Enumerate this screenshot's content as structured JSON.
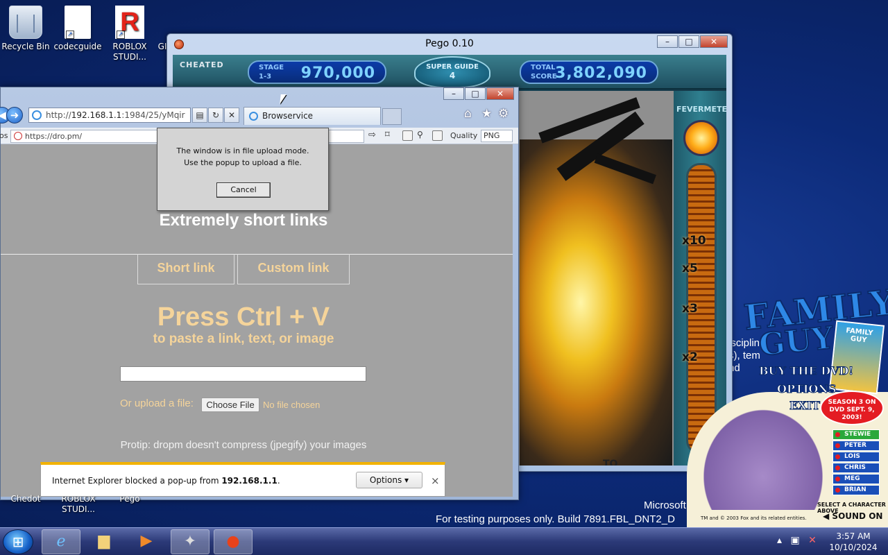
{
  "desktop": {
    "icons": [
      {
        "label": "Recycle Bin",
        "icon": "recycle-bin-icon"
      },
      {
        "label": "codecguide",
        "icon": "document-shortcut-icon"
      },
      {
        "label": "ROBLOX STUDI...",
        "icon": "roblox-icon"
      },
      {
        "label": "GI",
        "icon": "gimp-icon"
      }
    ],
    "bottom_icons": [
      {
        "label": "Chedot"
      },
      {
        "label": "ROBLOX STUDI..."
      },
      {
        "label": "Pego"
      }
    ],
    "watermark_line1": "Microsoft",
    "watermark_line2": "For testing purposes only. Build 7891.FBL_DNT2_D",
    "background_text": [
      "iscipline",
      "s), tem",
      "nd"
    ]
  },
  "pego": {
    "title": "Pego 0.10",
    "cheated_label": "CHEATED",
    "stage_label": "STAGE",
    "stage_value": "1-3",
    "stage_score": "970,000",
    "super_guide_label": "SUPER GUIDE",
    "super_guide_count": "4",
    "total_label": "TOTAL",
    "score_label": "SCORE",
    "total_score": "3,802,090",
    "fevermeter_label": "FEVERMETER",
    "multipliers": [
      "x10",
      "x5",
      "x3",
      "x2"
    ],
    "playfield_label": "TO"
  },
  "browser": {
    "address_prefix": "http://",
    "address_host": "192.168.1.1",
    "address_rest": ":1984/25/yMqir",
    "tab_label": "Browservice",
    "inner_prefix": "os",
    "inner_address": "https://dro.pm/",
    "quality_label": "Quality",
    "quality_value": "PNG",
    "dialog": {
      "line1": "The window is in file upload mode.",
      "line2": "Use the popup to upload a file.",
      "cancel_label": "Cancel"
    },
    "page": {
      "headline": "Extremely short links",
      "short_link_label": "Short link",
      "custom_link_label": "Custom link",
      "press_label": "Press Ctrl + V",
      "paste_label": "to paste a link, text, or image",
      "upload_label": "Or upload a file:",
      "choose_file_label": "Choose File",
      "no_file_label": "No file chosen",
      "protip": "Protip: dropm doesn't compress (jpegify) your images"
    },
    "popup_bar": {
      "text_before": "Internet Explorer blocked a pop-up from ",
      "text_host": "192.168.1.1",
      "text_after": ".",
      "options_label": "Options",
      "close_label": "×"
    }
  },
  "family_guy": {
    "logo_line1": "FAMILY",
    "logo_line2": "GUY",
    "menu": [
      "BUY THE DVD!",
      "OPTIONS",
      "EXIT"
    ],
    "dvd_label": "FAMILY GUY",
    "season_text": "SEASON 3 ON DVD SEPT. 9, 2003!",
    "characters": [
      "STEWIE",
      "PETER",
      "LOIS",
      "CHRIS",
      "MEG",
      "BRIAN"
    ],
    "select_text": "SELECT A CHARACTER ABOVE",
    "sound_text": "SOUND ON",
    "trademark": "TM and © 2003 Fox and its related entities."
  },
  "taskbar": {
    "apps": [
      "internet-explorer-icon",
      "file-explorer-icon",
      "media-player-icon",
      "app-icon",
      "pego-icon"
    ],
    "time": "3:57 AM",
    "date": "10/10/2024"
  }
}
